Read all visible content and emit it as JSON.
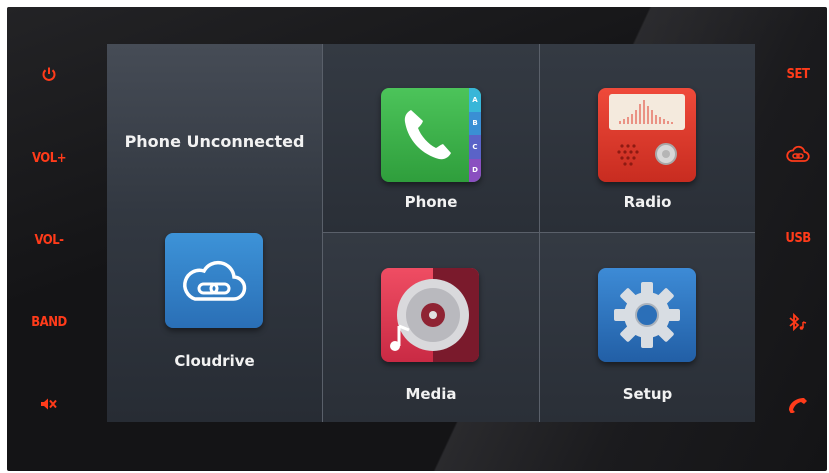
{
  "left_buttons": [
    {
      "id": "power",
      "icon": "power-icon",
      "label": ""
    },
    {
      "id": "vol-up",
      "label": "VOL+"
    },
    {
      "id": "vol-down",
      "label": "VOL-"
    },
    {
      "id": "band",
      "label": "BAND"
    },
    {
      "id": "mute",
      "icon": "mute-icon",
      "label": ""
    }
  ],
  "right_buttons": [
    {
      "id": "set",
      "label": "SET"
    },
    {
      "id": "cloud",
      "icon": "cloud-link-icon",
      "label": ""
    },
    {
      "id": "usb",
      "label": "USB"
    },
    {
      "id": "bluetooth",
      "icon": "bluetooth-music-icon",
      "label": ""
    },
    {
      "id": "hangup",
      "icon": "phone-hangup-icon",
      "label": ""
    }
  ],
  "status": {
    "phone_connection": "Phone Unconnected"
  },
  "apps": {
    "cloudrive": {
      "label": "Cloudrive",
      "icon": "cloud-link-icon",
      "color": "#2f7fc4"
    },
    "phone": {
      "label": "Phone",
      "icon": "phone-handset-icon",
      "color": "#3cb54a",
      "tabs": [
        "A",
        "B",
        "C",
        "D"
      ]
    },
    "radio": {
      "label": "Radio",
      "icon": "radio-icon",
      "color": "#e03a2c"
    },
    "media": {
      "label": "Media",
      "icon": "music-disc-icon",
      "color": "#e0384f"
    },
    "setup": {
      "label": "Setup",
      "icon": "gear-icon",
      "color": "#2b6fb8"
    }
  },
  "colors": {
    "hardware_accent": "#ff3b1a",
    "screen_bg": "#2a2f37",
    "bezel": "#141416"
  }
}
